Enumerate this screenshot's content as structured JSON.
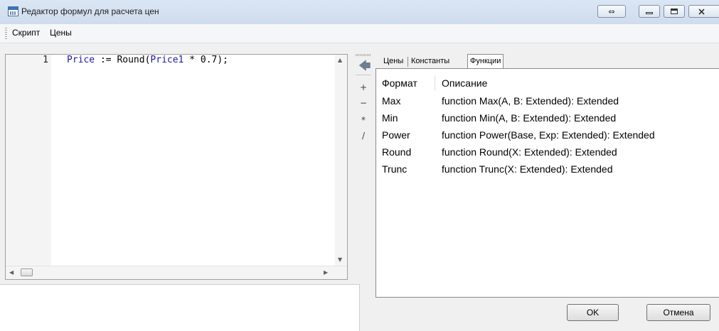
{
  "window": {
    "title": "Редактор формул для расчета цен",
    "buttons": {
      "swap_icon": "⇔"
    }
  },
  "menu": {
    "items": [
      {
        "label": "Скрипт"
      },
      {
        "label": "Цены"
      }
    ]
  },
  "editor": {
    "line_number": "1",
    "code": {
      "part1": "Price",
      "part2": " := Round(",
      "part3": "Price1",
      "part4": " * 0.7);"
    },
    "keyword_color": "#1a1aa6"
  },
  "operators": {
    "back_icon": "🡄",
    "items": [
      "+",
      "−",
      "*",
      "/"
    ]
  },
  "tabs": [
    {
      "label": "Цены"
    },
    {
      "label": "Константы"
    },
    {
      "label": "Функции",
      "active": true
    }
  ],
  "functions": {
    "header_name": "Формат",
    "header_desc": "Описание",
    "rows": [
      {
        "name": "Max",
        "desc": "function Max(A, B: Extended): Extended"
      },
      {
        "name": "Min",
        "desc": "function Min(A, B: Extended): Extended"
      },
      {
        "name": "Power",
        "desc": "function Power(Base, Exp: Extended): Extended"
      },
      {
        "name": "Round",
        "desc": "function Round(X: Extended): Extended"
      },
      {
        "name": "Trunc",
        "desc": "function Trunc(X: Extended): Extended"
      }
    ]
  },
  "dialog_buttons": {
    "ok": "OK",
    "cancel": "Отмена"
  }
}
